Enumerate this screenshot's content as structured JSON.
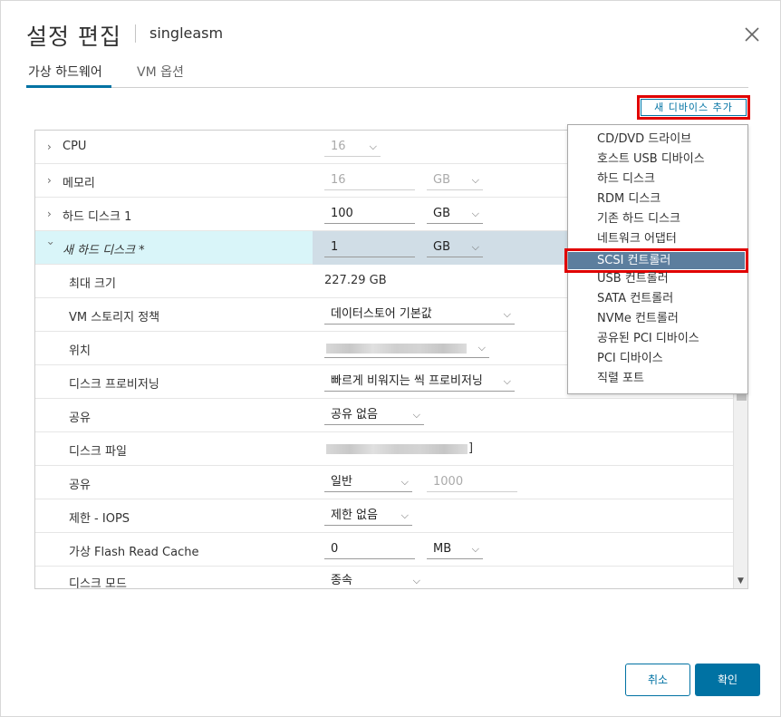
{
  "dialog": {
    "title": "설정 편집",
    "subtitle": "singleasm",
    "close_icon": "close-icon"
  },
  "tabs": [
    {
      "label": "가상 하드웨어",
      "active": true
    },
    {
      "label": "VM 옵션",
      "active": false
    }
  ],
  "add_device_label": "새 디바이스 추가",
  "rows": {
    "cpu": {
      "label": "CPU",
      "value": "16"
    },
    "memory": {
      "label": "메모리",
      "value": "16",
      "unit": "GB"
    },
    "hdd1": {
      "label": "하드 디스크 1",
      "value": "100",
      "unit": "GB"
    },
    "newhdd": {
      "label": "새 하드 디스크 *",
      "value": "1",
      "unit": "GB"
    },
    "maxsize": {
      "label": "최대 크기",
      "value": "227.29 GB"
    },
    "storage_policy": {
      "label": "VM 스토리지 정책",
      "value": "데이터스토어 기본값"
    },
    "location": {
      "label": "위치"
    },
    "provisioning": {
      "label": "디스크 프로비저닝",
      "value": "빠르게 비워지는 씩 프로비저닝"
    },
    "sharing": {
      "label": "공유",
      "value": "공유 없음"
    },
    "disk_file": {
      "label": "디스크 파일",
      "suffix": "]"
    },
    "shares": {
      "label": "공유",
      "value": "일반",
      "number": "1000"
    },
    "limit_iops": {
      "label": "제한 - IOPS",
      "value": "제한 없음"
    },
    "flash_cache": {
      "label": "가상 Flash Read Cache",
      "value": "0",
      "unit": "MB"
    },
    "disk_mode": {
      "label": "디스크 모드",
      "value": "종속"
    }
  },
  "menu_items": [
    "CD/DVD 드라이브",
    "호스트 USB 디바이스",
    "하드 디스크",
    "RDM 디스크",
    "기존 하드 디스크",
    "네트워크 어댑터",
    "SCSI 컨트롤러",
    "USB 컨트롤러",
    "SATA 컨트롤러",
    "NVMe 컨트롤러",
    "공유된 PCI 디바이스",
    "PCI 디바이스",
    "직렬 포트"
  ],
  "selected_menu_item": "SCSI 컨트롤러",
  "footer": {
    "cancel": "취소",
    "ok": "확인"
  },
  "colors": {
    "accent": "#0072a3",
    "highlight_row": "#d9f5f9",
    "menu_selected": "#5c7e9e",
    "annotation_red": "#e00000"
  }
}
